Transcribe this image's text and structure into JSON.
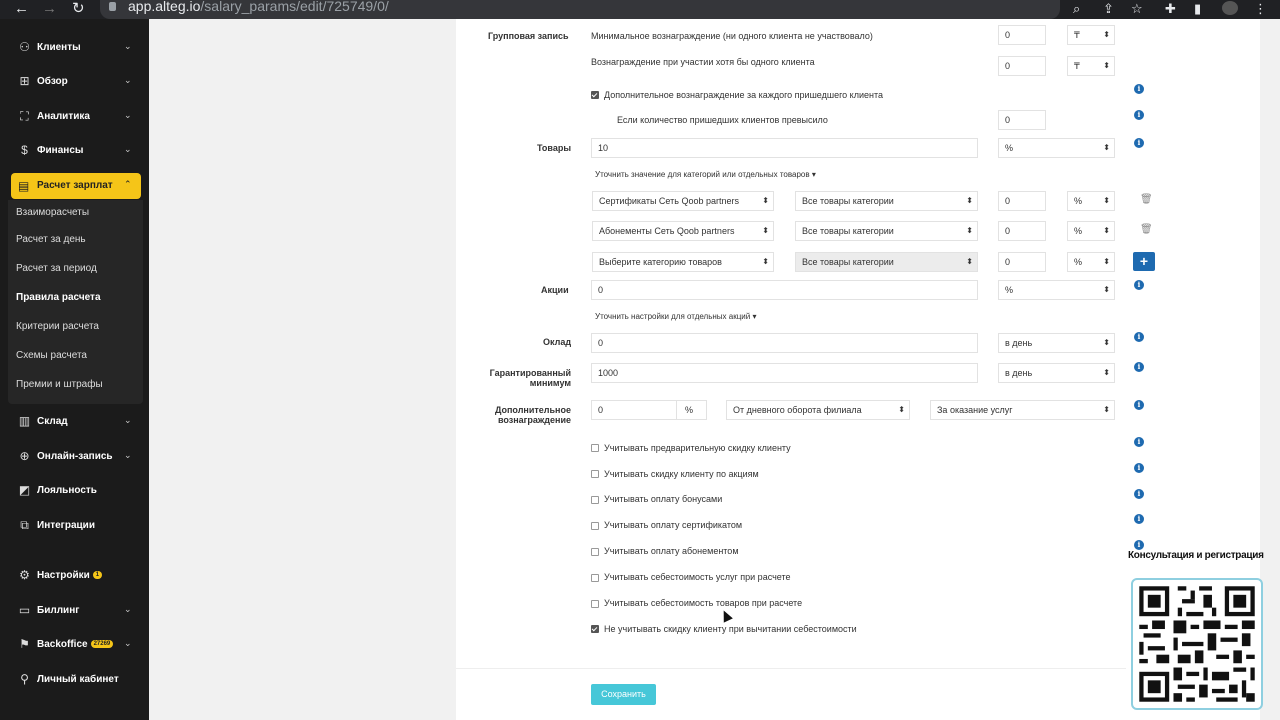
{
  "browser": {
    "host": "app.alteg.io",
    "path": "/salary_params/edit/725749/0/"
  },
  "sidebar": {
    "items": [
      {
        "label": "Клиенты",
        "icon": "clients-icon"
      },
      {
        "label": "Обзор",
        "icon": "overview-icon"
      },
      {
        "label": "Аналитика",
        "icon": "analytics-icon"
      },
      {
        "label": "Финансы",
        "icon": "finance-icon"
      },
      {
        "label": "Расчет зарплат",
        "icon": "salary-icon"
      },
      {
        "label": "Склад",
        "icon": "warehouse-icon"
      },
      {
        "label": "Онлайн-запись",
        "icon": "online-booking-icon"
      },
      {
        "label": "Лояльность",
        "icon": "loyalty-icon"
      },
      {
        "label": "Интеграции",
        "icon": "integrations-icon"
      },
      {
        "label": "Настройки",
        "icon": "settings-icon",
        "badge": "1"
      },
      {
        "label": "Биллинг",
        "icon": "billing-icon"
      },
      {
        "label": "Backoffice",
        "icon": "backoffice-icon",
        "badge": "27269"
      },
      {
        "label": "Личный кабинет",
        "icon": "account-icon"
      }
    ],
    "sub": [
      "Взаиморасчеты",
      "Расчет за день",
      "Расчет за период",
      "Правила расчета",
      "Критерии расчета",
      "Схемы расчета",
      "Премии и штрафы"
    ]
  },
  "form": {
    "group": {
      "label": "Групповая запись",
      "min_reward_text": "Минимальное вознаграждение (ни одного клиента не участвовало)",
      "min_reward_value": "0",
      "min_reward_unit": "₸",
      "one_client_text": "Вознаграждение при участии хотя бы одного клиента",
      "one_client_value": "0",
      "one_client_unit": "₸",
      "extra_text": "Дополнительное вознаграждение за каждого пришедшего клиента",
      "threshold_text": "Если количество пришедших клиентов превысило",
      "threshold_value": "0"
    },
    "goods": {
      "label": "Товары",
      "value": "10",
      "unit": "%",
      "refine_link": "Уточнить значение для категорий или отдельных товаров ▾",
      "rows": [
        {
          "category": "Сертификаты Сеть Qoob partners",
          "product": "Все товары категории",
          "value": "0",
          "unit": "%"
        },
        {
          "category": "Абонементы Сеть Qoob partners",
          "product": "Все товары категории",
          "value": "0",
          "unit": "%"
        },
        {
          "category": "Выберите категорию товаров",
          "product": "Все товары категории",
          "value": "0",
          "unit": "%"
        }
      ],
      "add_label": "+"
    },
    "promo": {
      "label": "Акции",
      "value": "0",
      "unit": "%",
      "refine_link": "Уточнить настройки для отдельных акций ▾"
    },
    "salary": {
      "label": "Оклад",
      "value": "0",
      "period": "в день"
    },
    "guaranteed": {
      "label_1": "Гарантированный",
      "label_2": "минимум",
      "value": "1000",
      "period": "в день"
    },
    "additional": {
      "label_1": "Дополнительное",
      "label_2": "вознаграждение",
      "value": "0",
      "unit": "%",
      "base": "От дневного оборота филиала",
      "type": "За оказание услуг"
    },
    "options": [
      {
        "label": "Учитывать предварительную скидку клиенту",
        "checked": false
      },
      {
        "label": "Учитывать скидку клиенту по акциям",
        "checked": false
      },
      {
        "label": "Учитывать оплату бонусами",
        "checked": false
      },
      {
        "label": "Учитывать оплату сертификатом",
        "checked": false
      },
      {
        "label": "Учитывать оплату абонементом",
        "checked": false
      },
      {
        "label": "Учитывать себестоимость услуг при расчете",
        "checked": false
      },
      {
        "label": "Учитывать себестоимость товаров при расчете",
        "checked": false
      },
      {
        "label": "Не учитывать скидку клиенту при вычитании себестоимости",
        "checked": true
      }
    ],
    "save_label": "Сохранить"
  },
  "overlay": {
    "qr_title": "Консультация и регистрация"
  },
  "colors": {
    "accent": "#f5c518",
    "info": "#1e6ab0",
    "save": "#46c7d8",
    "sidebar": "#1b1b1b"
  }
}
